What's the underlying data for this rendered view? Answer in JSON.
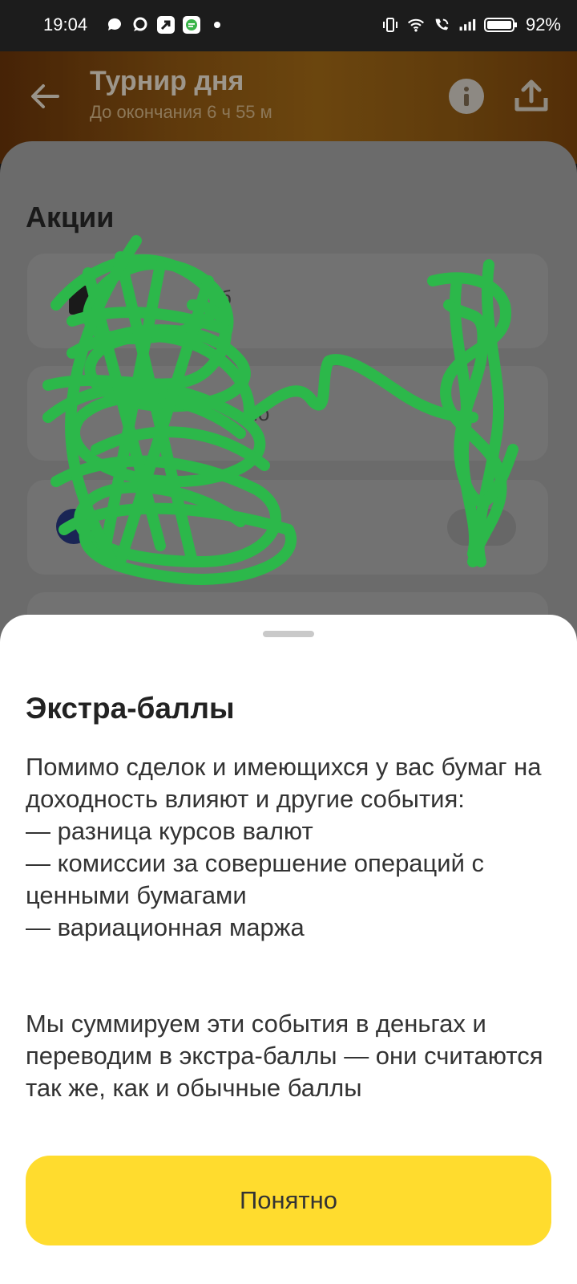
{
  "status_bar": {
    "time": "19:04",
    "battery_percent": "92%",
    "left_icons": [
      "chat-bubble-icon",
      "message-icon",
      "arrow-up-right-icon",
      "chat-app-icon",
      "dot-icon"
    ],
    "right_icons": [
      "vibrate-icon",
      "wifi-icon",
      "wifi-call-icon",
      "signal-icon",
      "battery-icon"
    ]
  },
  "header": {
    "title": "Турнир дня",
    "subtitle": "До окончания 6 ч 55 м",
    "icons": [
      "back-arrow-icon",
      "info-icon",
      "share-icon"
    ]
  },
  "content": {
    "section_title": "Акции",
    "rows": [
      {
        "partial_text": "б"
      },
      {
        "partial_text": "мо"
      },
      {
        "partial_text": ""
      }
    ],
    "row_badge_partial": "0"
  },
  "sheet": {
    "title": "Экстра-баллы",
    "intro": "Помимо сделок и имеющихся у вас бумаг на доходность влияют и другие события:",
    "items": [
      "— разница курсов валют",
      "— комиссии за совершение операций с ценными бумагами",
      "— вариационная маржа"
    ],
    "paragraph2": "Мы суммируем эти события в деньгах и переводим в экстра-баллы — они считаются так же, как и обычные баллы",
    "button_label": "Понятно"
  },
  "colors": {
    "accent_yellow": "#ffdc2e",
    "scribble_green": "#2cb84a"
  }
}
